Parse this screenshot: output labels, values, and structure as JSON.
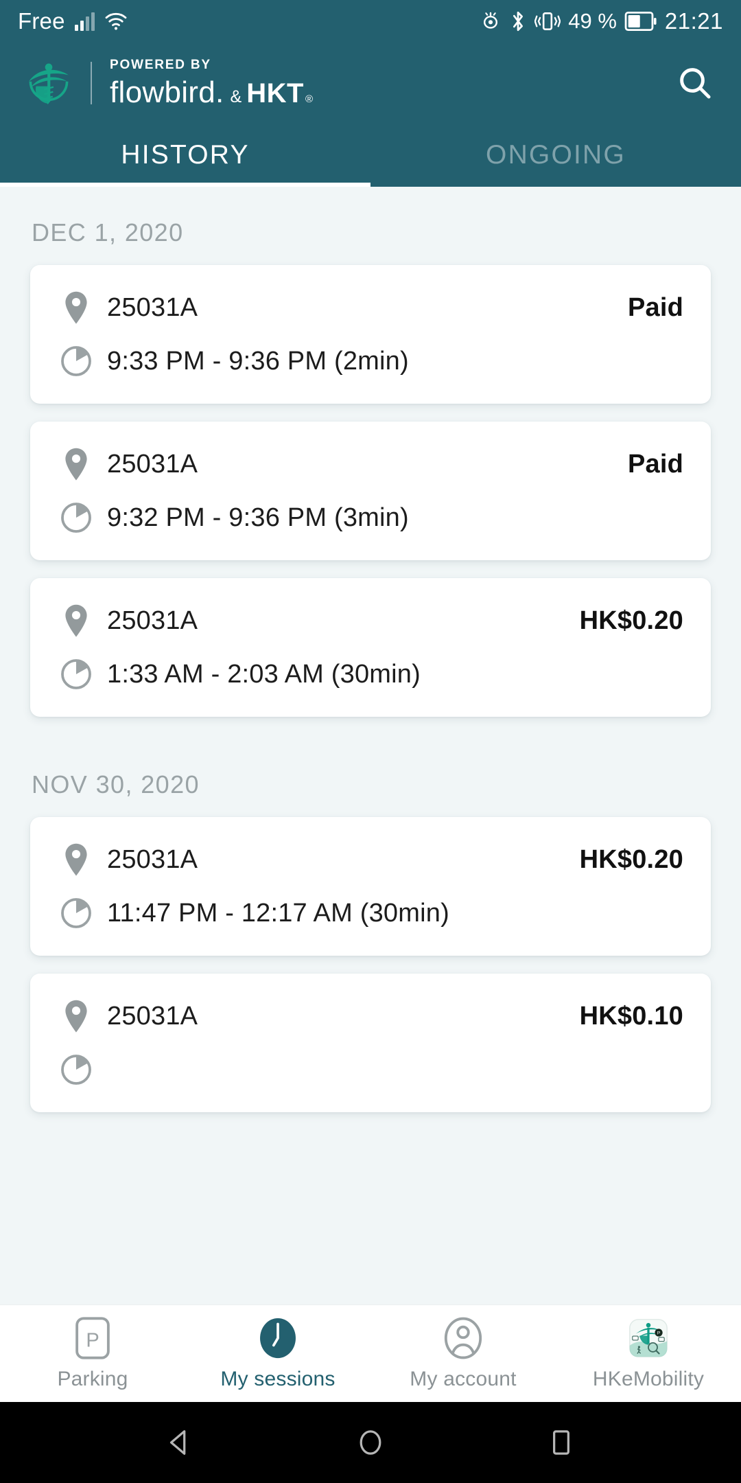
{
  "status_bar": {
    "carrier": "Free",
    "battery_percent": "49 %",
    "clock": "21:21",
    "icons": [
      "signal-icon",
      "wifi-icon",
      "eye-care-icon",
      "bluetooth-icon",
      "vibrate-icon",
      "battery-icon"
    ]
  },
  "app_bar": {
    "powered_by": "POWERED BY",
    "brand_primary": "flowbird.",
    "brand_amp": "&",
    "brand_partner": "HKT",
    "brand_registered": "®",
    "search_icon": "search-icon",
    "accent_color": "#23606f",
    "logo_color": "#16a588"
  },
  "tabs": [
    {
      "label": "HISTORY",
      "active": true
    },
    {
      "label": "ONGOING",
      "active": false
    }
  ],
  "sections": [
    {
      "date": "DEC 1, 2020",
      "sessions": [
        {
          "zone": "25031A",
          "time": "9:33 PM - 9:36 PM (2min)",
          "amount": "Paid"
        },
        {
          "zone": "25031A",
          "time": "9:32 PM - 9:36 PM (3min)",
          "amount": "Paid"
        },
        {
          "zone": "25031A",
          "time": "1:33 AM - 2:03 AM (30min)",
          "amount": "HK$0.20"
        }
      ]
    },
    {
      "date": "NOV 30, 2020",
      "sessions": [
        {
          "zone": "25031A",
          "time": "11:47 PM - 12:17 AM (30min)",
          "amount": "HK$0.20"
        },
        {
          "zone": "25031A",
          "time": "",
          "amount": "HK$0.10"
        }
      ]
    }
  ],
  "bottom_nav": [
    {
      "label": "Parking",
      "icon": "parking-p-icon",
      "active": false
    },
    {
      "label": "My sessions",
      "icon": "clock-filled-icon",
      "active": true
    },
    {
      "label": "My account",
      "icon": "user-circle-icon",
      "active": false
    },
    {
      "label": "HKeMobility",
      "icon": "hkemobility-app-icon",
      "active": false
    }
  ],
  "android_nav": {
    "back": "back-triangle-icon",
    "home": "home-circle-icon",
    "recents": "recents-square-icon"
  }
}
